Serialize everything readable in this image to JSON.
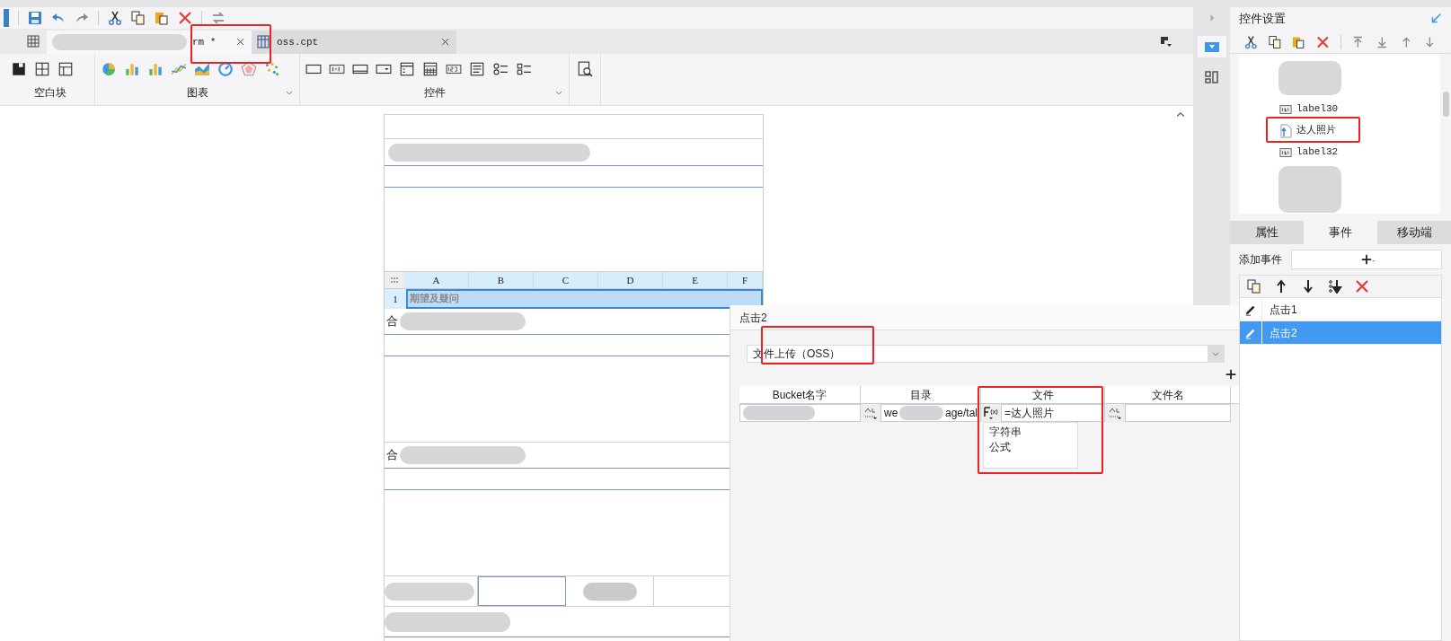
{
  "tabs": [
    {
      "label": "rm *",
      "selected": true,
      "blurred": true
    },
    {
      "label": "oss.cpt",
      "selected": false,
      "blurred": false
    }
  ],
  "ribbon_groups": [
    {
      "label": "空白块",
      "expandable": false
    },
    {
      "label": "图表",
      "expandable": true
    },
    {
      "label": "控件",
      "expandable": true
    }
  ],
  "sheet": {
    "columns": [
      "A",
      "B",
      "C",
      "D",
      "E",
      "F"
    ],
    "row_header": "1",
    "cell": "期望及疑问"
  },
  "form_labels": [
    "合",
    "合"
  ],
  "panel": {
    "title": "控件设置",
    "tree": [
      {
        "label": "label30",
        "kind": "label",
        "selected": false
      },
      {
        "label": "达人照片",
        "kind": "upload",
        "selected": false
      },
      {
        "label": "label32",
        "kind": "label",
        "selected": false
      }
    ],
    "tabs": [
      {
        "label": "属性",
        "selected": false
      },
      {
        "label": "事件",
        "selected": true
      },
      {
        "label": "移动端",
        "selected": false
      }
    ],
    "add_event_label": "添加事件",
    "events": [
      {
        "label": "点击1",
        "selected": false
      },
      {
        "label": "点击2",
        "selected": true
      }
    ]
  },
  "dialog": {
    "title": "点击2",
    "action": "文件上传（OSS）",
    "columns": [
      "Bucket名字",
      "目录",
      "文件",
      "文件名"
    ],
    "cells": [
      {
        "kind": "text"
      },
      {
        "kind": "string",
        "parts": [
          "we",
          "age/tal"
        ]
      },
      {
        "kind": "formula",
        "parts": [
          "=达人照片"
        ]
      },
      {
        "kind": "string"
      }
    ],
    "menu": [
      "字符串",
      "公式"
    ]
  }
}
